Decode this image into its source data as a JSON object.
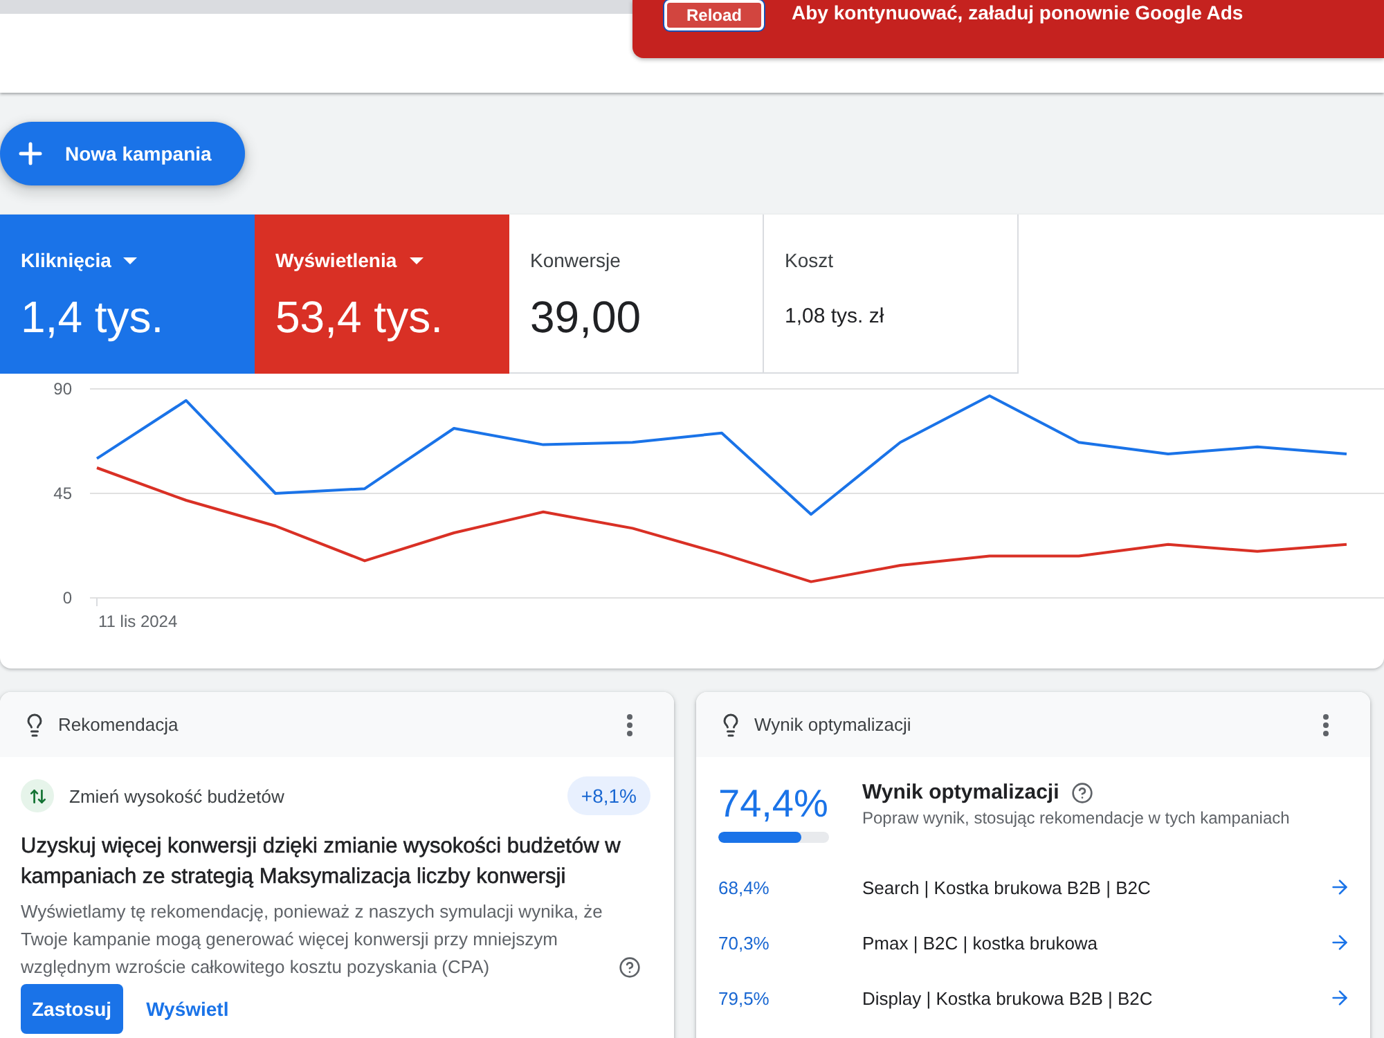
{
  "header": {
    "banner": {
      "button": "Reload",
      "message": "Aby kontynuować, załaduj ponownie Google Ads"
    }
  },
  "new_campaign_button": {
    "label": "Nowa kampania"
  },
  "metrics": {
    "tiles": [
      {
        "label": "Kliknięcia",
        "value": "1,4 tys.",
        "selected": true,
        "color": "#1a73e8"
      },
      {
        "label": "Wyświetlenia",
        "value": "53,4 tys.",
        "selected": true,
        "color": "#d93025"
      },
      {
        "label": "Konwersje",
        "value": "39,00",
        "selected": false
      },
      {
        "label": "Koszt",
        "value": "1,08 tys. zł",
        "selected": false
      }
    ],
    "chart_data": {
      "type": "line",
      "ylim": [
        0,
        90
      ],
      "yticks": [
        0,
        45,
        90
      ],
      "series": [
        {
          "color": "#1a73e8",
          "values": [
            60,
            85,
            45,
            47,
            73,
            66,
            67,
            71,
            36,
            67,
            87,
            67,
            62,
            65,
            62
          ]
        },
        {
          "color": "#d93025",
          "values": [
            56,
            42,
            31,
            16,
            28,
            37,
            30,
            19,
            7,
            14,
            18,
            18,
            23,
            20,
            23
          ]
        }
      ],
      "annotations": [
        "11 lis 2024"
      ]
    }
  },
  "recommendation_card": {
    "title": "Rekomendacja",
    "category": "Zmień wysokość budżetów",
    "badge": "+8,1%",
    "headline": "Uzyskuj więcej konwersji dzięki zmianie wysokości budżetów w kampaniach ze strategią Maksymalizacja liczby konwersji",
    "description": "Wyświetlamy tę rekomendację, ponieważ z naszych symulacji wynika, że Twoje kampanie mogą generować więcej konwersji przy mniejszym względnym wzroście całkowitego kosztu pozyskania (CPA)",
    "buttons": [
      {
        "label": "Zastosuj",
        "kind": "primary"
      },
      {
        "label": "Wyświetl",
        "kind": "text"
      }
    ]
  },
  "optimization_card": {
    "title": "Wynik optymalizacji",
    "score": "74,4%",
    "level": 0.744,
    "heading": "Wynik optymalizacji",
    "subheading": "Popraw wynik, stosując rekomendacje w tych kampaniach",
    "campaigns": [
      {
        "score": "68,4%",
        "name": "Search | Kostka brukowa B2B | B2C"
      },
      {
        "score": "70,3%",
        "name": "Pmax | B2C | kostka brukowa"
      },
      {
        "score": "79,5%",
        "name": "Display | Kostka brukowa B2B | B2C"
      }
    ]
  }
}
